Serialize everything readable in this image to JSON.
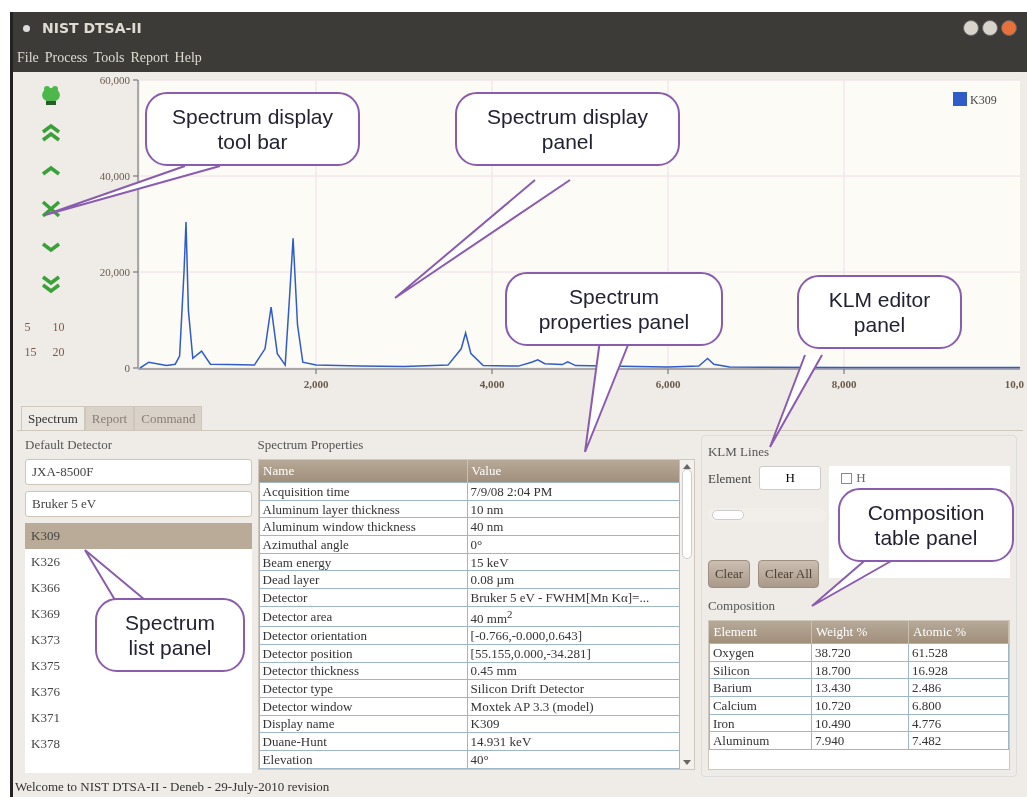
{
  "window": {
    "title": "NIST DTSA-II"
  },
  "menu": [
    {
      "label": "File"
    },
    {
      "label": "Process"
    },
    {
      "label": "Tools"
    },
    {
      "label": "Report"
    },
    {
      "label": "Help"
    }
  ],
  "toolbar": {
    "tools": [
      {
        "kind": "mascot"
      },
      {
        "kind": "double-up"
      },
      {
        "kind": "up"
      },
      {
        "kind": "cross"
      },
      {
        "kind": "down"
      },
      {
        "kind": "double-down"
      }
    ],
    "scale_buttons": [
      "5",
      "10",
      "15",
      "20"
    ]
  },
  "spectrum": {
    "edge_label": "10,0",
    "chart_data": {
      "type": "line",
      "grid": true,
      "xlim": [
        0,
        10000
      ],
      "ylim": [
        0,
        60000
      ],
      "xticks": [
        {
          "value": 2000,
          "label": "2,000"
        },
        {
          "value": 4000,
          "label": "4,000"
        },
        {
          "value": 6000,
          "label": "6,000"
        },
        {
          "value": 8000,
          "label": "8,000"
        }
      ],
      "yticks": [
        {
          "value": 0,
          "label": "0"
        },
        {
          "value": 20000,
          "label": "20,000"
        },
        {
          "value": 40000,
          "label": "40,000"
        },
        {
          "value": 60000,
          "label": "60,000"
        }
      ],
      "x": [
        0,
        100,
        300,
        400,
        450,
        500,
        523,
        550,
        600,
        700,
        800,
        1000,
        1300,
        1420,
        1490,
        1560,
        1650,
        1700,
        1740,
        1790,
        1850,
        2000,
        2500,
        3000,
        3500,
        3650,
        3700,
        3760,
        3900,
        4300,
        4450,
        4520,
        4600,
        4800,
        4860,
        4950,
        6000,
        6350,
        6400,
        6450,
        6520,
        6700,
        8000,
        10000
      ],
      "series": [
        {
          "name": "K309",
          "color": "#2f5cc8",
          "values": [
            0,
            1200,
            500,
            800,
            2500,
            20000,
            30400,
            12000,
            2000,
            3500,
            800,
            700,
            600,
            4000,
            12700,
            3000,
            600,
            15000,
            27000,
            9000,
            1200,
            600,
            400,
            300,
            600,
            4000,
            7300,
            3000,
            500,
            400,
            1200,
            1700,
            900,
            700,
            1300,
            500,
            200,
            400,
            1200,
            2000,
            800,
            200,
            100,
            100
          ]
        }
      ]
    }
  },
  "tabs": [
    {
      "label": "Spectrum",
      "selected": true
    },
    {
      "label": "Report",
      "selected": false
    },
    {
      "label": "Command",
      "selected": false
    }
  ],
  "detector": {
    "title": "Default Detector",
    "instrument": "JXA-8500F",
    "detector": "Bruker 5 eV"
  },
  "spectra": [
    {
      "label": "K309",
      "selected": true
    },
    {
      "label": "K326",
      "selected": false
    },
    {
      "label": "K366",
      "selected": false
    },
    {
      "label": "K369",
      "selected": false
    },
    {
      "label": "K373",
      "selected": false
    },
    {
      "label": "K375",
      "selected": false
    },
    {
      "label": "K376",
      "selected": false
    },
    {
      "label": "K371",
      "selected": false
    },
    {
      "label": "K378",
      "selected": false
    }
  ],
  "properties": {
    "title": "Spectrum Properties",
    "columns": [
      "Name",
      "Value"
    ],
    "rows": [
      [
        "Acquisition time",
        "7/9/08 2:04 PM"
      ],
      [
        "Aluminum layer thickness",
        "10 nm"
      ],
      [
        "Aluminum window thickness",
        "40 nm"
      ],
      [
        "Azimuthal angle",
        "0°"
      ],
      [
        "Beam energy",
        "15 keV"
      ],
      [
        "Dead layer",
        "0.08 µm"
      ],
      [
        "Detector",
        "Bruker 5 eV - FWHM[Mn Kα]=..."
      ],
      [
        "Detector area",
        "40 mm$^{2}$"
      ],
      [
        "Detector orientation",
        "[-0.766,-0.000,0.643]"
      ],
      [
        "Detector position",
        "[55.155,0.000,-34.281]"
      ],
      [
        "Detector thickness",
        "0.45 mm"
      ],
      [
        "Detector type",
        "Silicon Drift Detector"
      ],
      [
        "Detector window",
        "Moxtek AP 3.3 (model)"
      ],
      [
        "Display name",
        "K309"
      ],
      [
        "Duane-Hunt",
        "14.931 keV"
      ],
      [
        "Elevation",
        "40°"
      ]
    ]
  },
  "klm": {
    "title": "KLM Lines",
    "element_label": "Element",
    "element_value": "H",
    "lines": [
      {
        "label": "H",
        "checked": false
      }
    ],
    "buttons": [
      {
        "label": "Clear"
      },
      {
        "label": "Clear All"
      }
    ]
  },
  "composition": {
    "title": "Composition",
    "columns": [
      "Element",
      "Weight %",
      "Atomic %"
    ],
    "rows": [
      [
        "Oxygen",
        "38.720",
        "61.528"
      ],
      [
        "Silicon",
        "18.700",
        "16.928"
      ],
      [
        "Barium",
        "13.430",
        "2.486"
      ],
      [
        "Calcium",
        "10.720",
        "6.800"
      ],
      [
        "Iron",
        "10.490",
        "4.776"
      ],
      [
        "Aluminum",
        "7.940",
        "7.482"
      ]
    ]
  },
  "status_bar": "Welcome to NIST DTSA-II - Deneb - 29-July-2010 revision",
  "callouts": [
    "Spectrum display tool bar",
    "Spectrum display panel",
    "Spectrum list panel",
    "Spectrum properties panel",
    "KLM editor panel",
    "Composition table panel"
  ]
}
